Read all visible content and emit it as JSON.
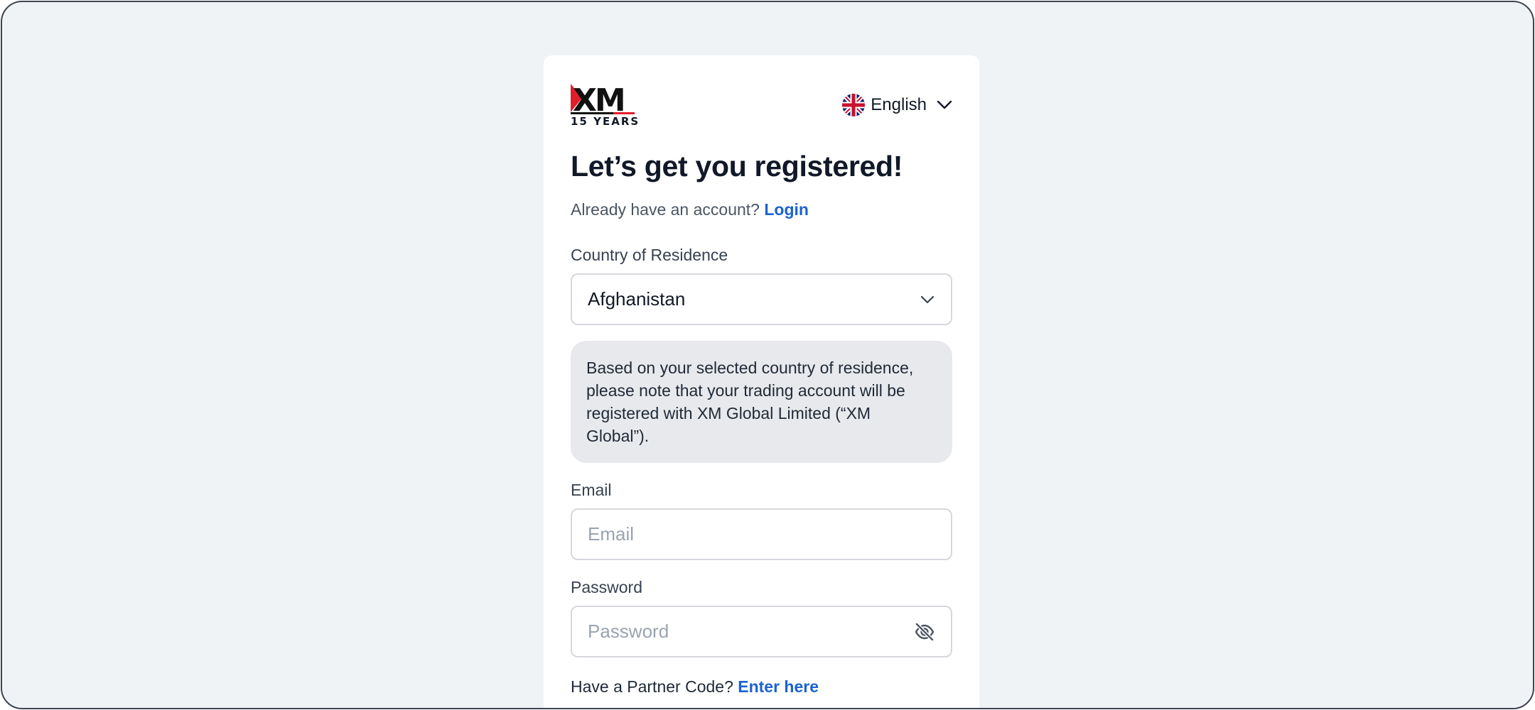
{
  "logo": {
    "mark": "XM",
    "tagline": "15 YEARS",
    "icon": "xm-logo"
  },
  "language": {
    "label": "English",
    "flag_icon": "uk-flag-icon"
  },
  "heading": "Let’s get you registered!",
  "login_prompt": {
    "text": "Already have an account?",
    "link": "Login"
  },
  "country": {
    "label": "Country of Residence",
    "value": "Afghanistan",
    "notice": "Based on your selected country of residence, please note that your trading account will be registered with XM Global Limited (“XM Global”)."
  },
  "email": {
    "label": "Email",
    "placeholder": "Email"
  },
  "password": {
    "label": "Password",
    "placeholder": "Password",
    "toggle_icon": "eye-off-icon"
  },
  "partner": {
    "text": "Have a Partner Code?",
    "link": "Enter here"
  },
  "colors": {
    "accent": "#1a63d1",
    "brand_red": "#e11d2a",
    "text": "#111827",
    "background": "#f0f3f6"
  }
}
